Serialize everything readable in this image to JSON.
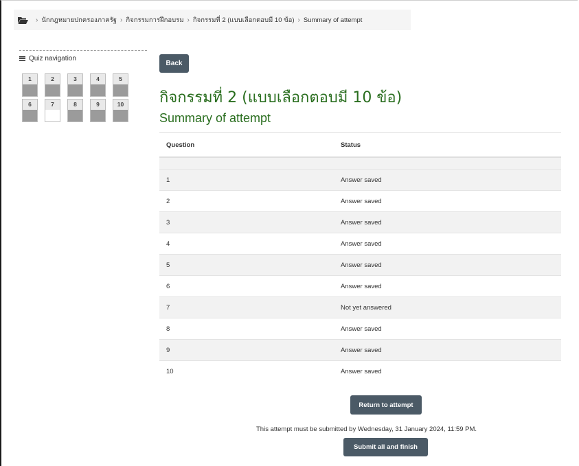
{
  "breadcrumb": {
    "icon": "folder-open-icon",
    "items": [
      "นักกฎหมายปกครองภาครัฐ",
      "กิจกรรมการฝึกอบรม",
      "กิจกรรมที่ 2 (แบบเลือกตอบมี 10 ข้อ)",
      "Summary of attempt"
    ]
  },
  "quiz_nav": {
    "title": "Quiz navigation",
    "buttons": [
      {
        "label": "1",
        "state": "answered"
      },
      {
        "label": "2",
        "state": "answered"
      },
      {
        "label": "3",
        "state": "answered"
      },
      {
        "label": "4",
        "state": "answered"
      },
      {
        "label": "5",
        "state": "answered"
      },
      {
        "label": "6",
        "state": "answered"
      },
      {
        "label": "7",
        "state": "not-answered"
      },
      {
        "label": "8",
        "state": "answered"
      },
      {
        "label": "9",
        "state": "answered"
      },
      {
        "label": "10",
        "state": "answered"
      }
    ]
  },
  "back_label": "Back",
  "page_title": "กิจกรรมที่ 2 (แบบเลือกตอบมี 10 ข้อ)",
  "page_subtitle": "Summary of attempt",
  "table": {
    "headers": [
      "Question",
      "Status"
    ],
    "rows": [
      {
        "question": "1",
        "status": "Answer saved"
      },
      {
        "question": "2",
        "status": "Answer saved"
      },
      {
        "question": "3",
        "status": "Answer saved"
      },
      {
        "question": "4",
        "status": "Answer saved"
      },
      {
        "question": "5",
        "status": "Answer saved"
      },
      {
        "question": "6",
        "status": "Answer saved"
      },
      {
        "question": "7",
        "status": "Not yet answered"
      },
      {
        "question": "8",
        "status": "Answer saved"
      },
      {
        "question": "9",
        "status": "Answer saved"
      },
      {
        "question": "10",
        "status": "Answer saved"
      }
    ]
  },
  "return_label": "Return to attempt",
  "deadline_text": "This attempt must be submitted by Wednesday, 31 January 2024, 11:59 PM.",
  "submit_label": "Submit all and finish",
  "colors": {
    "title": "#2a6e1f",
    "button": "#4b5a66",
    "answered": "#9b9b9b"
  }
}
